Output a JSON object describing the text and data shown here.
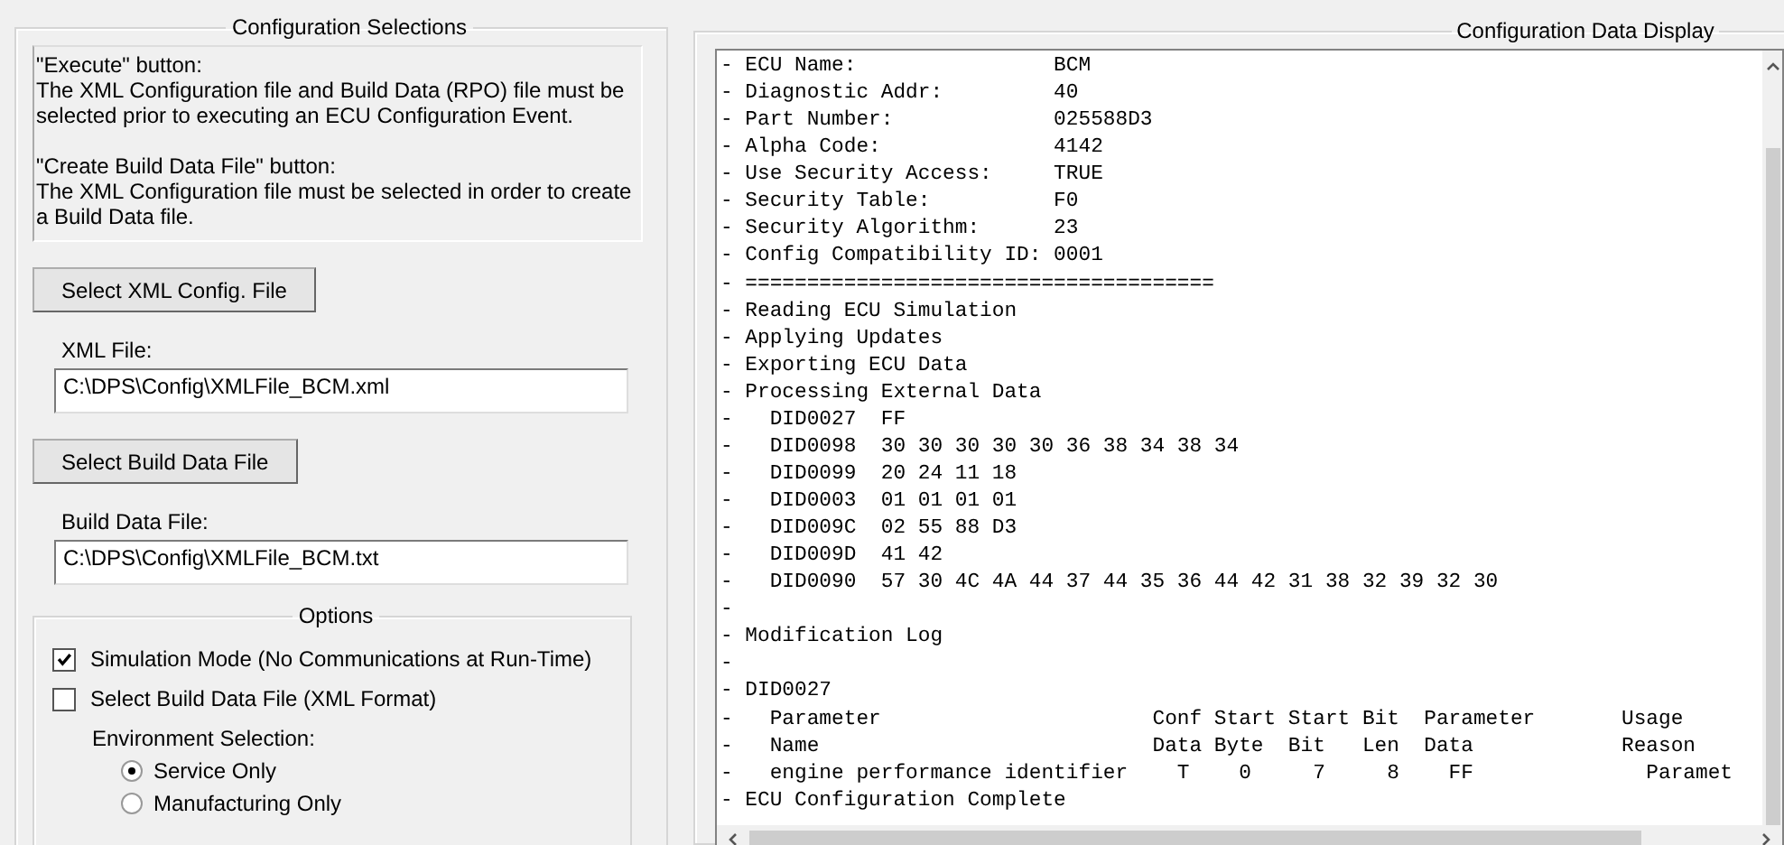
{
  "config_selections": {
    "title": "Configuration Selections",
    "info": [
      {
        "heading": "\"Execute\" button:",
        "text": "The XML Configuration file and Build Data (RPO) file must be selected prior to executing an ECU Configuration Event."
      },
      {
        "heading": "\"Create Build Data File\" button:",
        "text": "The XML Configuration file must be selected in order to create a Build Data file."
      }
    ],
    "files": [
      {
        "button": "Select XML Config. File",
        "label": "XML File:",
        "value": "C:\\DPS\\Config\\XMLFile_BCM.xml"
      },
      {
        "button": "Select Build Data File",
        "label": "Build Data File:",
        "value": "C:\\DPS\\Config\\XMLFile_BCM.txt"
      }
    ],
    "options": {
      "title": "Options",
      "checkboxes": [
        {
          "label": "Simulation Mode (No Communications at Run-Time)",
          "checked": true
        },
        {
          "label": "Select Build Data File (XML Format)",
          "checked": false
        }
      ],
      "environment": {
        "label": "Environment Selection:",
        "radios": [
          {
            "label": "Service Only",
            "selected": true
          },
          {
            "label": "Manufacturing Only",
            "selected": false
          }
        ]
      }
    }
  },
  "config_display": {
    "title": "Configuration Data Display",
    "lines": [
      "- ECU Name:                BCM",
      "- Diagnostic Addr:         40",
      "- Part Number:             025588D3",
      "- Alpha Code:              4142",
      "- Use Security Access:     TRUE",
      "- Security Table:          F0",
      "- Security Algorithm:      23",
      "- Config Compatibility ID: 0001",
      "- ======================================",
      "- Reading ECU Simulation",
      "- Applying Updates",
      "- Exporting ECU Data",
      "- Processing External Data",
      "-   DID0027  FF",
      "-   DID0098  30 30 30 30 30 36 38 34 38 34",
      "-   DID0099  20 24 11 18",
      "-   DID0003  01 01 01 01",
      "-   DID009C  02 55 88 D3",
      "-   DID009D  41 42",
      "-   DID0090  57 30 4C 4A 44 37 44 35 36 44 42 31 38 32 39 32 30",
      "-",
      "- Modification Log",
      "-",
      "- DID0027",
      "-   Parameter                      Conf Start Start Bit  Parameter       Usage",
      "-   Name                           Data Byte  Bit   Len  Data            Reason",
      "-   engine performance identifier    T    0     7     8    FF              Paramet",
      "- ECU Configuration Complete"
    ]
  }
}
